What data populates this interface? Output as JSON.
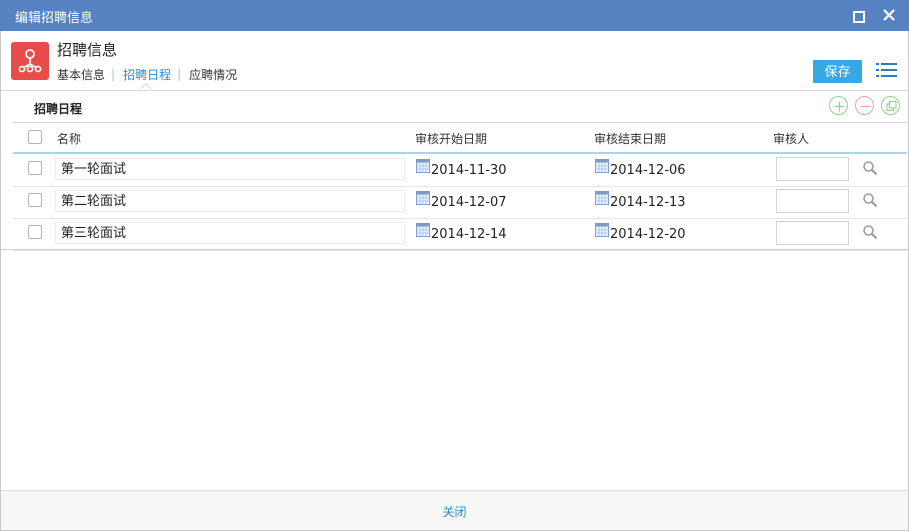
{
  "window": {
    "title": "编辑招聘信息"
  },
  "header": {
    "title": "招聘信息",
    "tabs": [
      {
        "label": "基本信息",
        "active": false
      },
      {
        "label": "招聘日程",
        "active": true
      },
      {
        "label": "应聘情况",
        "active": false
      }
    ],
    "save_label": "保存"
  },
  "section": {
    "title": "招聘日程"
  },
  "grid": {
    "columns": [
      "名称",
      "审核开始日期",
      "审核结束日期",
      "审核人"
    ],
    "rows": [
      {
        "name": "第一轮面试",
        "start": "2014-11-30",
        "end": "2014-12-06",
        "reviewer": ""
      },
      {
        "name": "第二轮面试",
        "start": "2014-12-07",
        "end": "2014-12-13",
        "reviewer": ""
      },
      {
        "name": "第三轮面试",
        "start": "2014-12-14",
        "end": "2014-12-20",
        "reviewer": ""
      }
    ]
  },
  "footer": {
    "close_label": "关闭"
  },
  "colors": {
    "titlebar": "#5682c1",
    "accent": "#3aa7e5",
    "app_icon": "#e94b4b",
    "link": "#2a8ad6"
  }
}
